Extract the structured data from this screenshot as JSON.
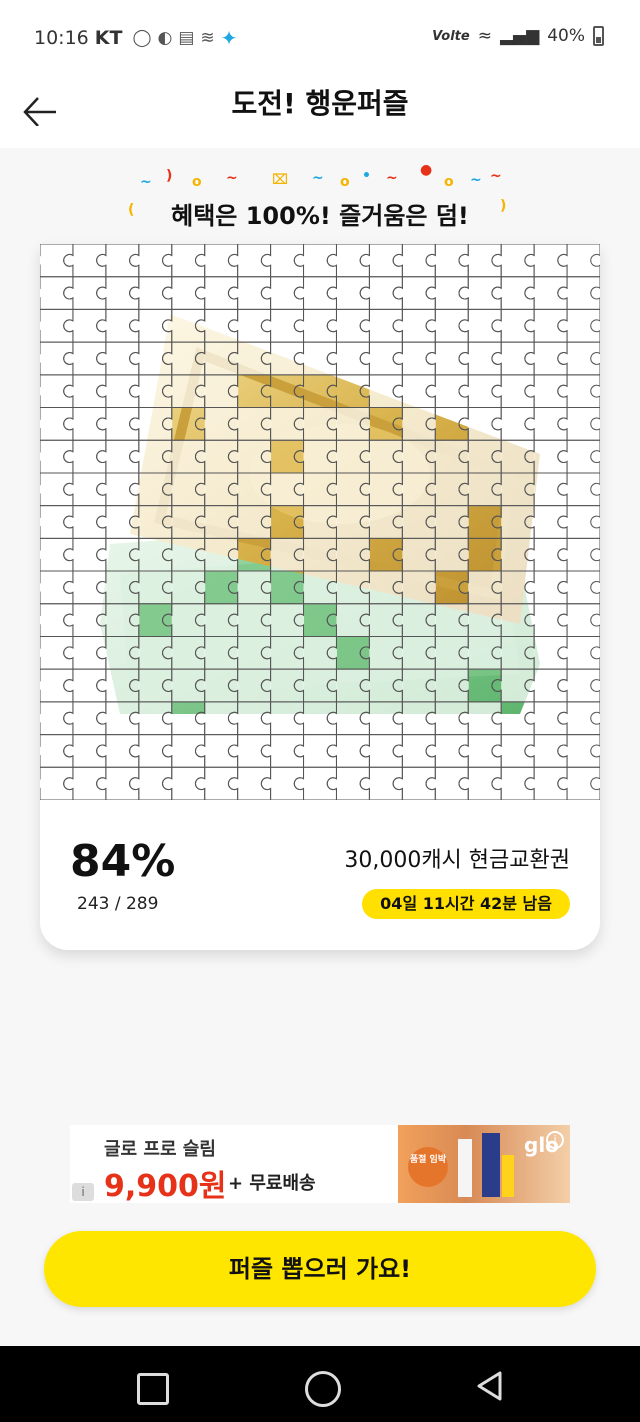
{
  "status_bar": {
    "time": "10:16",
    "carrier": "KT",
    "icons_left": [
      "pill-icon",
      "dashboard-icon",
      "clipboard-icon",
      "wireless-icon",
      "star-app-icon"
    ],
    "volte": "Volte",
    "battery": "40%"
  },
  "header": {
    "back_icon": "arrow-left-icon",
    "title": "도전! 행운퍼즐"
  },
  "slogan": {
    "prefix": "혜택은 ",
    "emph1": "100%!",
    "middle": " 즐거움은 ",
    "emph2": "덤!"
  },
  "puzzle": {
    "image": "gold cash card with green banknotes",
    "cols": 17,
    "rows": 17,
    "collected": 243,
    "total": 289,
    "revealed_fraction": 0.16
  },
  "progress": {
    "percent": "84%",
    "count": "243 / 289",
    "prize": "30,000캐시 현금교환권",
    "time_left": "04일 11시간 42분 남음"
  },
  "ad": {
    "line1": "글로 프로 슬림",
    "price": "9,900원",
    "shipping": "+ 무료배송",
    "sticker": "품절 임박",
    "brand": "glo",
    "info_icon": "info-icon"
  },
  "cta": {
    "label": "퍼즐 뽑으러 가요!"
  },
  "colors": {
    "accent": "#ffe600",
    "price_red": "#e63219",
    "background": "#f7f7f7"
  }
}
